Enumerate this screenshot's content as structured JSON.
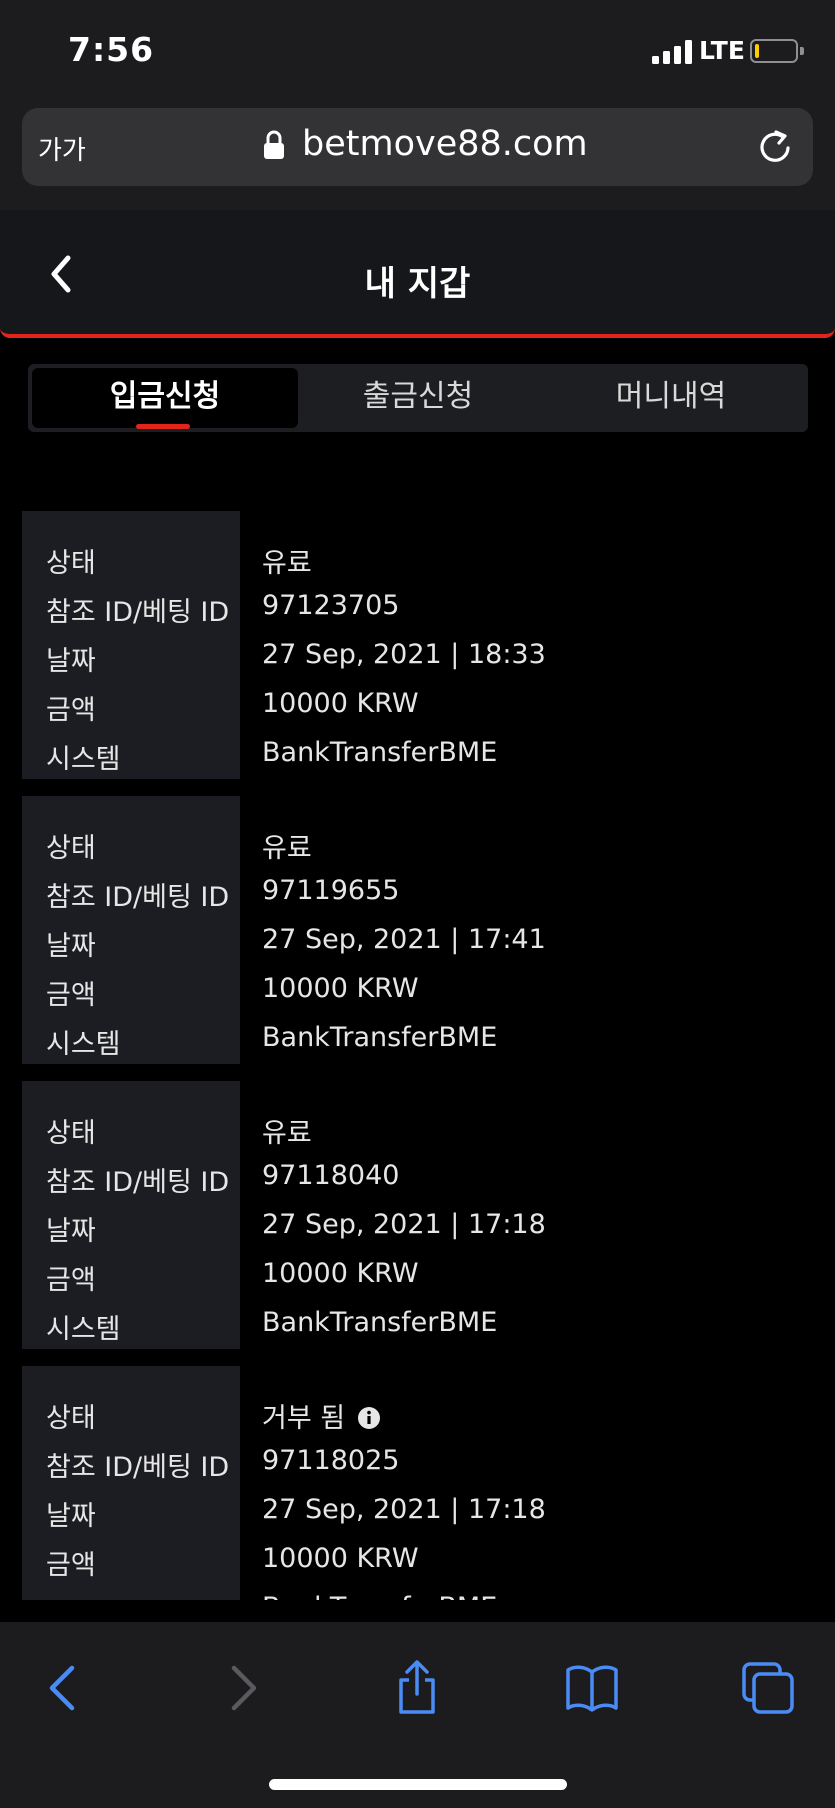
{
  "status_bar": {
    "time": "7:56",
    "network": "LTE"
  },
  "browser": {
    "text_size_label": "가가",
    "domain": "betmove88.com"
  },
  "header": {
    "title": "내 지갑"
  },
  "tabs": [
    {
      "label": "입금신청",
      "active": true
    },
    {
      "label": "출금신청",
      "active": false
    },
    {
      "label": "머니내역",
      "active": false
    }
  ],
  "records": [
    {
      "fields": [
        {
          "label": "상태",
          "value": "유료"
        },
        {
          "label": "참조 ID/베팅 ID",
          "value": "97123705"
        },
        {
          "label": "날짜",
          "value": "27 Sep, 2021 | 18:33"
        },
        {
          "label": "금액",
          "value": "10000 KRW"
        },
        {
          "label": "시스템",
          "value": "BankTransferBME"
        }
      ]
    },
    {
      "fields": [
        {
          "label": "상태",
          "value": "유료"
        },
        {
          "label": "참조 ID/베팅 ID",
          "value": "97119655"
        },
        {
          "label": "날짜",
          "value": "27 Sep, 2021 | 17:41"
        },
        {
          "label": "금액",
          "value": "10000 KRW"
        },
        {
          "label": "시스템",
          "value": "BankTransferBME"
        }
      ]
    },
    {
      "fields": [
        {
          "label": "상태",
          "value": "유료"
        },
        {
          "label": "참조 ID/베팅 ID",
          "value": "97118040"
        },
        {
          "label": "날짜",
          "value": "27 Sep, 2021 | 17:18"
        },
        {
          "label": "금액",
          "value": "10000 KRW"
        },
        {
          "label": "시스템",
          "value": "BankTransferBME"
        }
      ]
    },
    {
      "fields": [
        {
          "label": "상태",
          "value": "거부 됨",
          "icon": "info-icon"
        },
        {
          "label": "참조 ID/베팅 ID",
          "value": "97118025"
        },
        {
          "label": "날짜",
          "value": "27 Sep, 2021 | 17:18"
        },
        {
          "label": "금액",
          "value": "10000 KRW"
        },
        {
          "label": "시스템",
          "value": "BankTransferBME"
        }
      ]
    }
  ],
  "colors": {
    "accent": "#e1251b",
    "safari_blue": "#4a8bf5",
    "disabled": "#5a5a5e",
    "battery_low": "#ffcc00"
  }
}
